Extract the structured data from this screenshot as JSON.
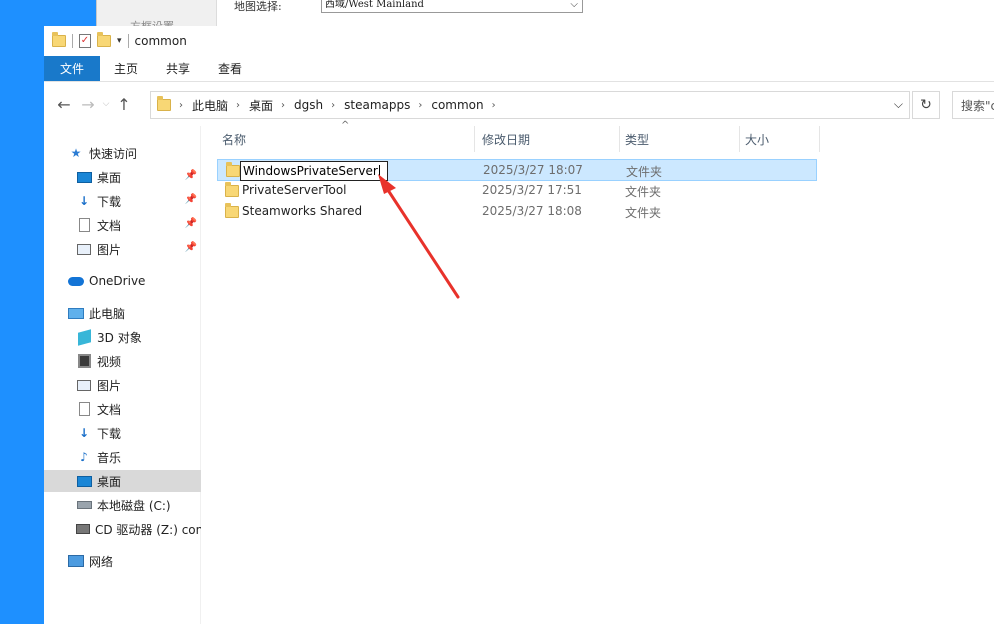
{
  "background_app": {
    "label_left": "方框设置",
    "map_label": "地图选择:",
    "map_value": "西域/West Mainland"
  },
  "window": {
    "title": "common"
  },
  "ribbon": {
    "tabs": [
      "文件",
      "主页",
      "共享",
      "查看"
    ]
  },
  "address": {
    "crumbs": [
      "此电脑",
      "桌面",
      "dgsh",
      "steamapps",
      "common"
    ],
    "search_placeholder": "搜索\"co"
  },
  "sidebar": {
    "items": [
      {
        "label": "快速访问",
        "icon": "star-icon"
      },
      {
        "label": "桌面",
        "icon": "desktop-icon",
        "pinned": true
      },
      {
        "label": "下载",
        "icon": "download-icon",
        "pinned": true
      },
      {
        "label": "文档",
        "icon": "document-icon",
        "pinned": true
      },
      {
        "label": "图片",
        "icon": "pictures-icon",
        "pinned": true
      },
      {
        "label": "OneDrive",
        "icon": "cloud-icon"
      },
      {
        "label": "此电脑",
        "icon": "computer-icon"
      },
      {
        "label": "3D 对象",
        "icon": "3d-objects-icon"
      },
      {
        "label": "视频",
        "icon": "video-icon"
      },
      {
        "label": "图片",
        "icon": "pictures-icon"
      },
      {
        "label": "文档",
        "icon": "document-icon"
      },
      {
        "label": "下载",
        "icon": "download-icon"
      },
      {
        "label": "音乐",
        "icon": "music-icon"
      },
      {
        "label": "桌面",
        "icon": "desktop-icon",
        "selected": true
      },
      {
        "label": "本地磁盘 (C:)",
        "icon": "disk-icon"
      },
      {
        "label": "CD 驱动器 (Z:) con",
        "icon": "cd-drive-icon"
      },
      {
        "label": "网络",
        "icon": "network-icon"
      }
    ]
  },
  "columns": [
    "名称",
    "修改日期",
    "类型",
    "大小"
  ],
  "files": [
    {
      "name": "WindowsPrivateServer",
      "date": "2025/3/27 18:07",
      "type": "文件夹",
      "renaming": true
    },
    {
      "name": "PrivateServerTool",
      "date": "2025/3/27 17:51",
      "type": "文件夹"
    },
    {
      "name": "Steamworks Shared",
      "date": "2025/3/27 18:08",
      "type": "文件夹"
    }
  ],
  "colors": {
    "accent": "#1979ca",
    "selection": "#cce8ff",
    "annotation_arrow": "#e8322b"
  }
}
